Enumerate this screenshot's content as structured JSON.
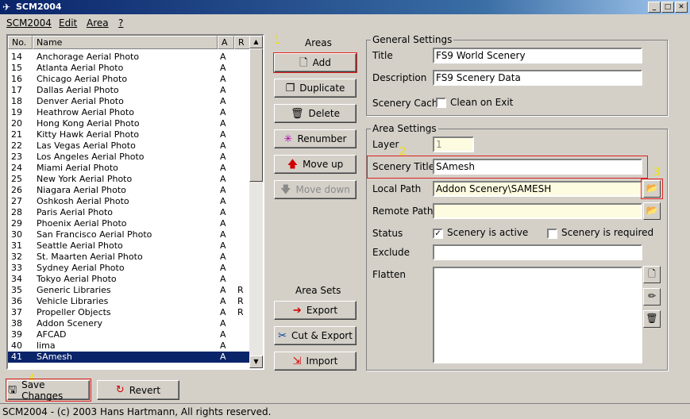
{
  "window": {
    "title": "SCM2004"
  },
  "menu": [
    "SCM2004",
    "Edit",
    "Area",
    "?"
  ],
  "list": {
    "headers": {
      "no": "No.",
      "name": "Name",
      "a": "A",
      "r": "R"
    },
    "rows": [
      {
        "no": "14",
        "name": "Anchorage Aerial Photo",
        "a": "A",
        "r": ""
      },
      {
        "no": "15",
        "name": "Atlanta Aerial Photo",
        "a": "A",
        "r": ""
      },
      {
        "no": "16",
        "name": "Chicago Aerial Photo",
        "a": "A",
        "r": ""
      },
      {
        "no": "17",
        "name": "Dallas Aerial Photo",
        "a": "A",
        "r": ""
      },
      {
        "no": "18",
        "name": "Denver Aerial Photo",
        "a": "A",
        "r": ""
      },
      {
        "no": "19",
        "name": "Heathrow Aerial Photo",
        "a": "A",
        "r": ""
      },
      {
        "no": "20",
        "name": "Hong Kong Aerial Photo",
        "a": "A",
        "r": ""
      },
      {
        "no": "21",
        "name": "Kitty Hawk Aerial Photo",
        "a": "A",
        "r": ""
      },
      {
        "no": "22",
        "name": "Las Vegas Aerial Photo",
        "a": "A",
        "r": ""
      },
      {
        "no": "23",
        "name": "Los Angeles Aerial Photo",
        "a": "A",
        "r": ""
      },
      {
        "no": "24",
        "name": "Miami Aerial Photo",
        "a": "A",
        "r": ""
      },
      {
        "no": "25",
        "name": "New York Aerial Photo",
        "a": "A",
        "r": ""
      },
      {
        "no": "26",
        "name": "Niagara Aerial Photo",
        "a": "A",
        "r": ""
      },
      {
        "no": "27",
        "name": "Oshkosh Aerial Photo",
        "a": "A",
        "r": ""
      },
      {
        "no": "28",
        "name": "Paris Aerial Photo",
        "a": "A",
        "r": ""
      },
      {
        "no": "29",
        "name": "Phoenix Aerial Photo",
        "a": "A",
        "r": ""
      },
      {
        "no": "30",
        "name": "San Francisco Aerial Photo",
        "a": "A",
        "r": ""
      },
      {
        "no": "31",
        "name": "Seattle Aerial Photo",
        "a": "A",
        "r": ""
      },
      {
        "no": "32",
        "name": "St. Maarten Aerial Photo",
        "a": "A",
        "r": ""
      },
      {
        "no": "33",
        "name": "Sydney Aerial Photo",
        "a": "A",
        "r": ""
      },
      {
        "no": "34",
        "name": "Tokyo Aerial Photo",
        "a": "A",
        "r": ""
      },
      {
        "no": "35",
        "name": "Generic Libraries",
        "a": "A",
        "r": "R"
      },
      {
        "no": "36",
        "name": "Vehicle Libraries",
        "a": "A",
        "r": "R"
      },
      {
        "no": "37",
        "name": "Propeller Objects",
        "a": "A",
        "r": "R"
      },
      {
        "no": "38",
        "name": "Addon Scenery",
        "a": "A",
        "r": ""
      },
      {
        "no": "39",
        "name": "AFCAD",
        "a": "A",
        "r": ""
      },
      {
        "no": "40",
        "name": "lima",
        "a": "A",
        "r": ""
      },
      {
        "no": "41",
        "name": "SAmesh",
        "a": "A",
        "r": "",
        "selected": true
      }
    ]
  },
  "areas": {
    "label": "Areas",
    "add": "Add",
    "duplicate": "Duplicate",
    "delete": "Delete",
    "renumber": "Renumber",
    "move_up": "Move up",
    "move_down": "Move down"
  },
  "area_sets": {
    "label": "Area Sets",
    "export": "Export",
    "cut_export": "Cut & Export",
    "import": "Import"
  },
  "general": {
    "title": "General Settings",
    "title_label": "Title",
    "title_value": "FS9 World Scenery",
    "description_label": "Description",
    "description_value": "FS9 Scenery Data",
    "cache_label": "Scenery Cache",
    "clean_label": "Clean on Exit"
  },
  "area_settings": {
    "title": "Area Settings",
    "layer_label": "Layer",
    "layer_value": "1",
    "scenery_title_label": "Scenery Title",
    "scenery_title_value": "SAmesh",
    "local_path_label": "Local Path",
    "local_path_value": "Addon Scenery\\SAMESH",
    "remote_path_label": "Remote Path",
    "remote_path_value": "",
    "status_label": "Status",
    "active_label": "Scenery is active",
    "required_label": "Scenery is required",
    "exclude_label": "Exclude",
    "flatten_label": "Flatten"
  },
  "bottom": {
    "save": "Save Changes",
    "revert": "Revert"
  },
  "annotations": [
    "1",
    "2",
    "3",
    "4"
  ],
  "status": {
    "text": "SCM2004 - (c) 2003 Hans Hartmann, All rights reserved."
  },
  "colors": {
    "highlight": "#e02020",
    "annotation": "#f0e000",
    "selection": "#0a246a"
  }
}
